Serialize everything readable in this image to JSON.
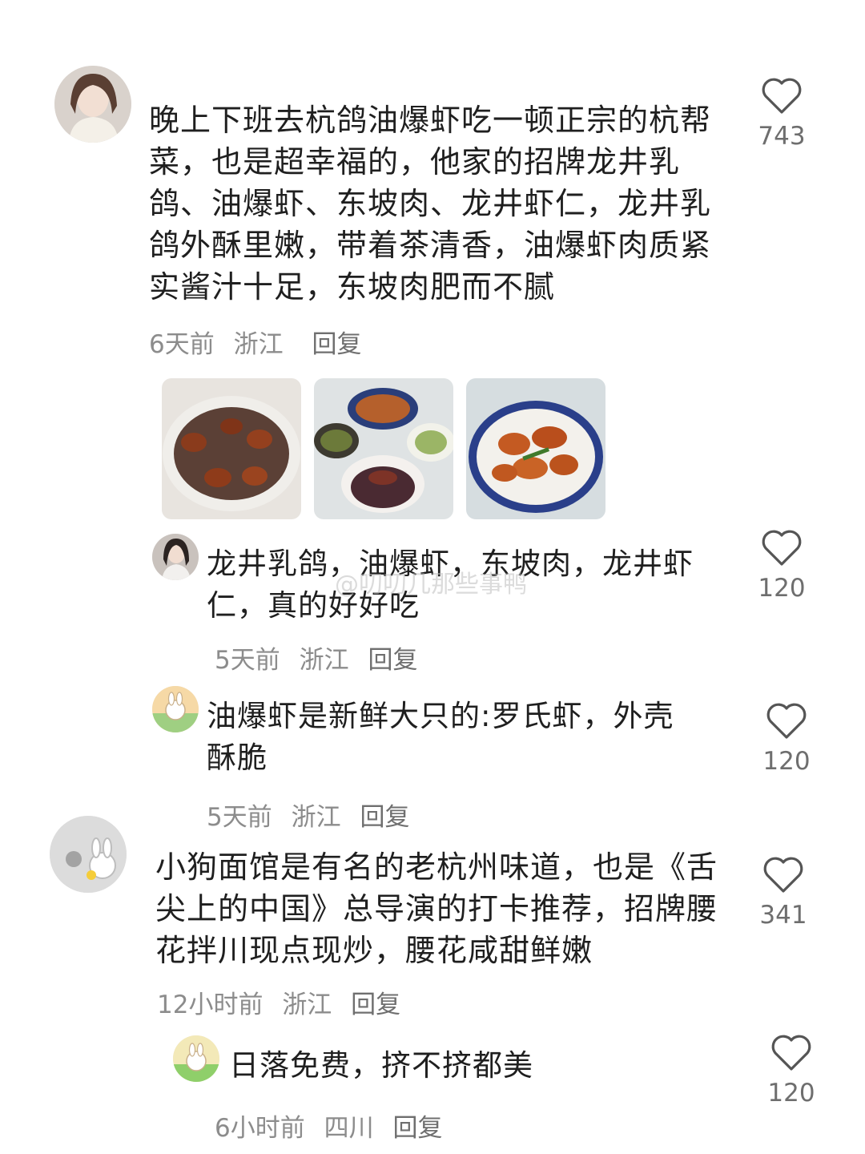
{
  "watermark": "@叨叨几那些事鸭",
  "comments": [
    {
      "text": "晚上下班去杭鸽油爆虾吃一顿正宗的杭帮菜，也是超幸福的，他家的招牌龙井乳鸽、油爆虾、东坡肉、龙井虾仁，龙井乳鸽外酥里嫩，带着茶清香，油爆虾肉质紧实酱汁十足，东坡肉肥而不腻",
      "time": "6天前",
      "location": "浙江",
      "reply_label": "回复",
      "likes": "743",
      "images": [
        "roast-pigeon-photo",
        "table-dishes-photo",
        "braised-shrimp-photo"
      ]
    },
    {
      "text": "龙井乳鸽，油爆虾，东坡肉，龙井虾仁，真的好好吃",
      "time": "5天前",
      "location": "浙江",
      "reply_label": "回复",
      "likes": "120"
    },
    {
      "text": "油爆虾是新鲜大只的:罗氏虾，外壳酥脆",
      "time": "5天前",
      "location": "浙江",
      "reply_label": "回复",
      "likes": "120"
    },
    {
      "text": "小狗面馆是有名的老杭州味道，也是《舌尖上的中国》总导演的打卡推荐，招牌腰花拌川现点现炒，腰花咸甜鲜嫩",
      "time": "12小时前",
      "location": "浙江",
      "reply_label": "回复",
      "likes": "341"
    },
    {
      "text": "日落免费，挤不挤都美",
      "time": "6小时前",
      "location": "四川",
      "reply_label": "回复",
      "likes": "120"
    }
  ]
}
